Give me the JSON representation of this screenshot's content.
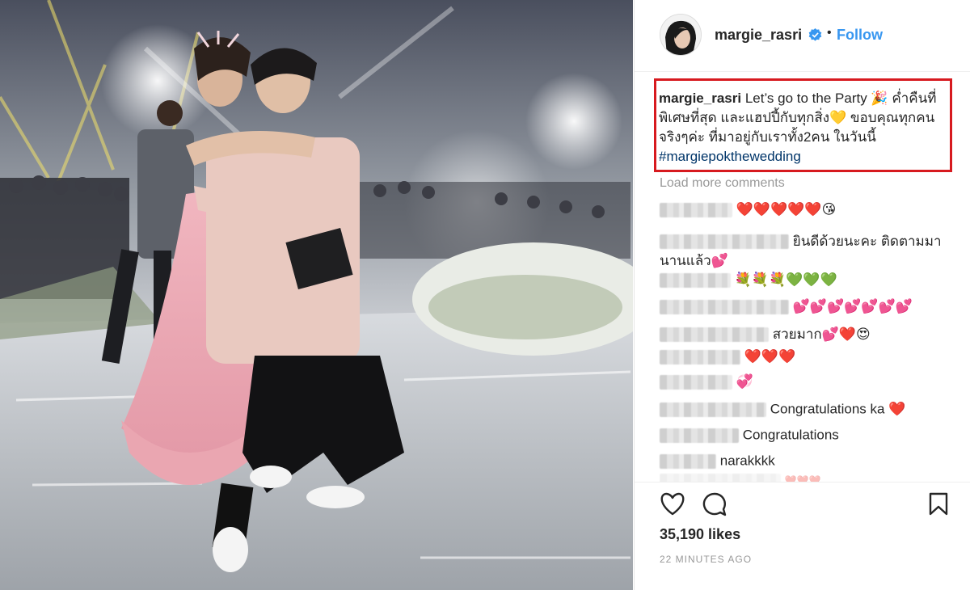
{
  "post": {
    "username": "margie_rasri",
    "separator": "•",
    "follow_label": "Follow",
    "caption": {
      "username": "margie_rasri",
      "text": "Let’s go to the Party 🎉 ค่ำคืนที่พิเศษที่สุด และแฮปปี้กับทุกสิ่ง💛 ขอบคุณทุกคนจริงๆค่ะ ที่มาอยู่กับเราทั้ง2คน ในวันนี้ ",
      "hashtag": "#margiepokthewedding"
    },
    "load_more": "Load more comments",
    "comments": [
      {
        "text": "❤️❤️❤️❤️❤️😘"
      },
      {
        "text": "ยินดีด้วยนะคะ ติดตามมา"
      },
      {
        "text": "นานแล้ว💕"
      },
      {
        "text": "💐💐💐💚💚💚"
      },
      {
        "text": "💕💕💕💕💕💕💕"
      },
      {
        "text": "สวยมาก💕❤️😍"
      },
      {
        "text": "❤️❤️❤️"
      },
      {
        "text": "💞"
      },
      {
        "text": "Congratulations ka ❤️"
      },
      {
        "text": "Congratulations"
      },
      {
        "text": "narakkkk"
      },
      {
        "text": "❤️❤️❤️"
      }
    ],
    "likes": "35,190 likes",
    "time": "22 MINUTES AGO",
    "icons": [
      "heart-icon",
      "comment-icon",
      "bookmark-icon",
      "verified-badge-icon"
    ]
  },
  "colors": {
    "follow": "#3897f0",
    "highlight_box": "#d71a1f",
    "hashtag": "#003569",
    "muted": "#999999"
  }
}
